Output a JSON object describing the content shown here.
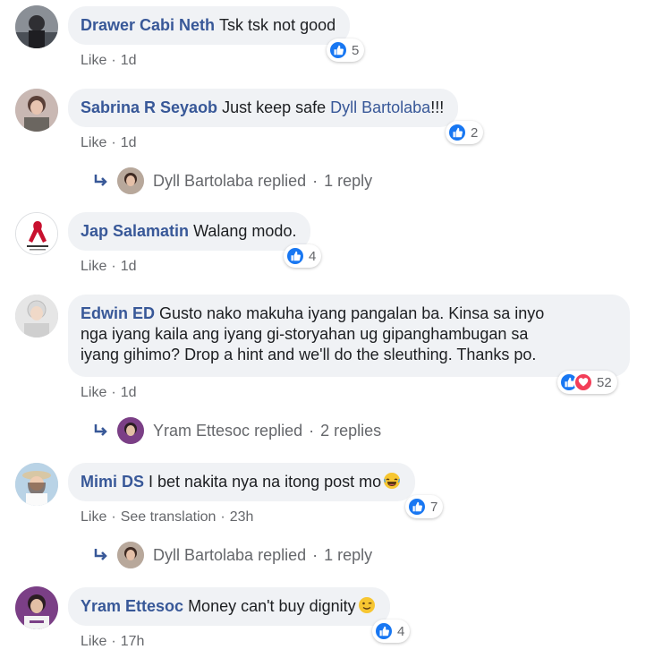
{
  "comments": [
    {
      "author": "Drawer Cabi Neth",
      "text": "Tsk tsk not good",
      "like": "Like",
      "time": "1d",
      "reaction_count": "5",
      "reactions": [
        "like"
      ]
    },
    {
      "author": "Sabrina R Seyaob",
      "text_before": "Just keep safe ",
      "mention": "Dyll Bartolaba",
      "text_after": "!!!",
      "like": "Like",
      "time": "1d",
      "reaction_count": "2",
      "reactions": [
        "like"
      ],
      "replies": {
        "name": "Dyll Bartolaba",
        "replied": "replied",
        "count": "1 reply"
      }
    },
    {
      "author": "Jap Salamatin",
      "text": "Walang modo.",
      "like": "Like",
      "time": "1d",
      "reaction_count": "4",
      "reactions": [
        "like"
      ]
    },
    {
      "author": "Edwin ED",
      "text_line1": "Gusto nako makuha iyang pangalan ba. Kinsa sa inyo",
      "text_line2": "nga iyang kaila ang iyang gi-storyahan ug gipanghambugan sa",
      "text_line3": "iyang gihimo? Drop a hint and we'll do the sleuthing. Thanks po.",
      "like": "Like",
      "time": "1d",
      "reaction_count": "52",
      "reactions": [
        "like",
        "love"
      ],
      "replies": {
        "name": "Yram Ettesoc",
        "replied": "replied",
        "count": "2 replies"
      }
    },
    {
      "author": "Mimi DS",
      "text": "I bet nakita nya na itong post mo",
      "emoji": "laughing-emoji",
      "like": "Like",
      "see_translation": "See translation",
      "time": "23h",
      "reaction_count": "7",
      "reactions": [
        "like"
      ],
      "replies": {
        "name": "Dyll Bartolaba",
        "replied": "replied",
        "count": "1 reply"
      }
    },
    {
      "author": "Yram Ettesoc",
      "text": "Money can't buy dignity",
      "emoji": "winking-emoji",
      "like": "Like",
      "time": "17h",
      "reaction_count": "4",
      "reactions": [
        "like"
      ]
    }
  ],
  "separator": "·",
  "colors": {
    "author": "#385898",
    "bubble": "#f0f2f5",
    "meta": "#65676b",
    "like_blue": "#1877f2",
    "love_red": "#f33e58"
  }
}
